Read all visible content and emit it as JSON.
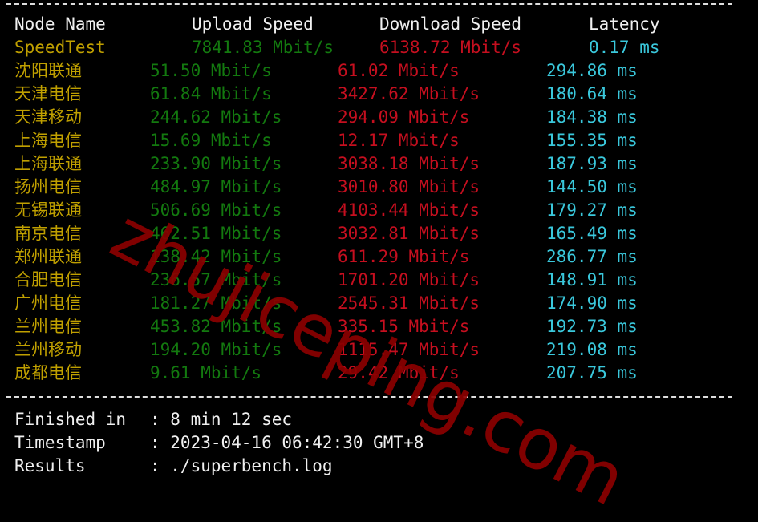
{
  "header": {
    "node": "Node Name",
    "upload": "Upload Speed",
    "download": "Download Speed",
    "latency": "Latency"
  },
  "speedtest": {
    "node": "SpeedTest",
    "upload": "7841.83 Mbit/s",
    "download": "6138.72 Mbit/s",
    "latency": "0.17 ms"
  },
  "rows": [
    {
      "node": "沈阳联通",
      "upload": "51.50 Mbit/s",
      "download": "61.02 Mbit/s",
      "latency": "294.86 ms"
    },
    {
      "node": "天津电信",
      "upload": "61.84 Mbit/s",
      "download": "3427.62 Mbit/s",
      "latency": "180.64 ms"
    },
    {
      "node": "天津移动",
      "upload": "244.62 Mbit/s",
      "download": "294.09 Mbit/s",
      "latency": "184.38 ms"
    },
    {
      "node": "上海电信",
      "upload": "15.69 Mbit/s",
      "download": "12.17 Mbit/s",
      "latency": "155.35 ms"
    },
    {
      "node": "上海联通",
      "upload": "233.90 Mbit/s",
      "download": "3038.18 Mbit/s",
      "latency": "187.93 ms"
    },
    {
      "node": "扬州电信",
      "upload": "484.97 Mbit/s",
      "download": "3010.80 Mbit/s",
      "latency": "144.50 ms"
    },
    {
      "node": "无锡联通",
      "upload": "506.69 Mbit/s",
      "download": "4103.44 Mbit/s",
      "latency": "179.27 ms"
    },
    {
      "node": "南京电信",
      "upload": "462.51 Mbit/s",
      "download": "3032.81 Mbit/s",
      "latency": "165.49 ms"
    },
    {
      "node": "郑州联通",
      "upload": "138.42 Mbit/s",
      "download": "611.29 Mbit/s",
      "latency": "286.77 ms"
    },
    {
      "node": "合肥电信",
      "upload": "236.57 Mbit/s",
      "download": "1701.20 Mbit/s",
      "latency": "148.91 ms"
    },
    {
      "node": "广州电信",
      "upload": "181.27 Mbit/s",
      "download": "2545.31 Mbit/s",
      "latency": "174.90 ms"
    },
    {
      "node": "兰州电信",
      "upload": "453.82 Mbit/s",
      "download": "335.15 Mbit/s",
      "latency": "192.73 ms"
    },
    {
      "node": "兰州移动",
      "upload": "194.20 Mbit/s",
      "download": "1115.47 Mbit/s",
      "latency": "219.08 ms"
    },
    {
      "node": "成都电信",
      "upload": "9.61 Mbit/s",
      "download": "29.42 Mbit/s",
      "latency": "207.75 ms"
    }
  ],
  "footer": [
    {
      "label": "Finished in",
      "value": ": 8 min 12 sec"
    },
    {
      "label": "Timestamp",
      "value": ": 2023-04-16 06:42:30 GMT+8"
    },
    {
      "label": "Results",
      "value": ": ./superbench.log"
    }
  ],
  "watermark": "zhujiceping.com",
  "colors": {
    "node": "#c0a000",
    "upload": "#13790f",
    "download": "#c50f1f",
    "latency": "#3ac8dc",
    "watermark": "#8b0000"
  }
}
